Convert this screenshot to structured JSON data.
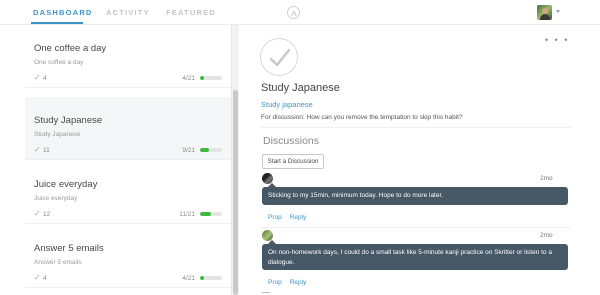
{
  "nav": {
    "tabs": [
      {
        "label": "DASHBOARD",
        "active": true
      },
      {
        "label": "ACTIVITY",
        "active": false
      },
      {
        "label": "FEATURED",
        "active": false
      }
    ],
    "logo_icon": "a-logo-icon",
    "user_avatar_icon": "avatar",
    "menu_caret_icon": "chevron-down-icon"
  },
  "colors": {
    "accent": "#3e95c5",
    "progress": "#3fba3f",
    "bubble": "#465766",
    "selected_row": "#f4f6f8"
  },
  "habits": [
    {
      "title": "One coffee a day",
      "subtitle": "One coffee a day",
      "checkins": "4",
      "ratio": "4/21",
      "progress": 0.19
    },
    {
      "title": "Study Japanese",
      "subtitle": "Study Japanese",
      "checkins": "11",
      "ratio": "9/21",
      "progress": 0.43,
      "selected": true
    },
    {
      "title": "Juice everyday",
      "subtitle": "Juice everyday",
      "checkins": "12",
      "ratio": "11/21",
      "progress": 0.52
    },
    {
      "title": "Answer 5 emails",
      "subtitle": "Answer 5 emails",
      "checkins": "4",
      "ratio": "4/21",
      "progress": 0.19
    }
  ],
  "detail": {
    "more_icon": "more-dots-icon",
    "check_icon": "checkmark-icon",
    "title": "Study Japanese",
    "link": "Study japanese",
    "prompt": "For discussion: How can you remove the temptation to skip this habit?",
    "discussions_heading": "Discussions",
    "start_button": "Start a Discussion",
    "comments": [
      {
        "time": "2mo",
        "text": "Sticking to my 15min, minimum today. Hope to do more later.",
        "prop": "Prop",
        "reply": "Reply"
      },
      {
        "time": "2mo",
        "text": "On non-homework days, I could do a small task like 5-minute kanji practice on Skritter or listen to a dialogue.",
        "prop": "Prop",
        "reply": "Reply"
      }
    ]
  }
}
